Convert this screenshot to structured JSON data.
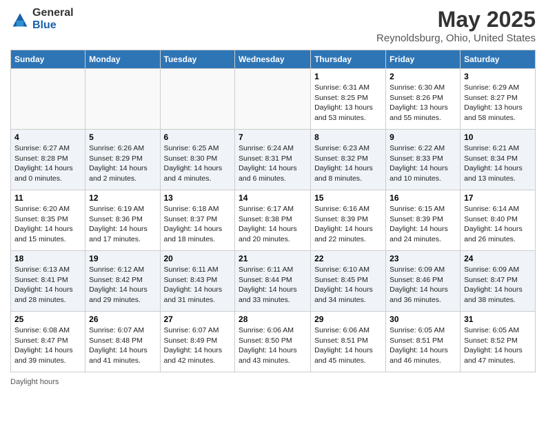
{
  "header": {
    "logo_general": "General",
    "logo_blue": "Blue",
    "main_title": "May 2025",
    "subtitle": "Reynoldsburg, Ohio, United States"
  },
  "days_of_week": [
    "Sunday",
    "Monday",
    "Tuesday",
    "Wednesday",
    "Thursday",
    "Friday",
    "Saturday"
  ],
  "weeks": [
    [
      {
        "day": "",
        "info": ""
      },
      {
        "day": "",
        "info": ""
      },
      {
        "day": "",
        "info": ""
      },
      {
        "day": "",
        "info": ""
      },
      {
        "day": "1",
        "info": "Sunrise: 6:31 AM\nSunset: 8:25 PM\nDaylight: 13 hours\nand 53 minutes."
      },
      {
        "day": "2",
        "info": "Sunrise: 6:30 AM\nSunset: 8:26 PM\nDaylight: 13 hours\nand 55 minutes."
      },
      {
        "day": "3",
        "info": "Sunrise: 6:29 AM\nSunset: 8:27 PM\nDaylight: 13 hours\nand 58 minutes."
      }
    ],
    [
      {
        "day": "4",
        "info": "Sunrise: 6:27 AM\nSunset: 8:28 PM\nDaylight: 14 hours\nand 0 minutes."
      },
      {
        "day": "5",
        "info": "Sunrise: 6:26 AM\nSunset: 8:29 PM\nDaylight: 14 hours\nand 2 minutes."
      },
      {
        "day": "6",
        "info": "Sunrise: 6:25 AM\nSunset: 8:30 PM\nDaylight: 14 hours\nand 4 minutes."
      },
      {
        "day": "7",
        "info": "Sunrise: 6:24 AM\nSunset: 8:31 PM\nDaylight: 14 hours\nand 6 minutes."
      },
      {
        "day": "8",
        "info": "Sunrise: 6:23 AM\nSunset: 8:32 PM\nDaylight: 14 hours\nand 8 minutes."
      },
      {
        "day": "9",
        "info": "Sunrise: 6:22 AM\nSunset: 8:33 PM\nDaylight: 14 hours\nand 10 minutes."
      },
      {
        "day": "10",
        "info": "Sunrise: 6:21 AM\nSunset: 8:34 PM\nDaylight: 14 hours\nand 13 minutes."
      }
    ],
    [
      {
        "day": "11",
        "info": "Sunrise: 6:20 AM\nSunset: 8:35 PM\nDaylight: 14 hours\nand 15 minutes."
      },
      {
        "day": "12",
        "info": "Sunrise: 6:19 AM\nSunset: 8:36 PM\nDaylight: 14 hours\nand 17 minutes."
      },
      {
        "day": "13",
        "info": "Sunrise: 6:18 AM\nSunset: 8:37 PM\nDaylight: 14 hours\nand 18 minutes."
      },
      {
        "day": "14",
        "info": "Sunrise: 6:17 AM\nSunset: 8:38 PM\nDaylight: 14 hours\nand 20 minutes."
      },
      {
        "day": "15",
        "info": "Sunrise: 6:16 AM\nSunset: 8:39 PM\nDaylight: 14 hours\nand 22 minutes."
      },
      {
        "day": "16",
        "info": "Sunrise: 6:15 AM\nSunset: 8:39 PM\nDaylight: 14 hours\nand 24 minutes."
      },
      {
        "day": "17",
        "info": "Sunrise: 6:14 AM\nSunset: 8:40 PM\nDaylight: 14 hours\nand 26 minutes."
      }
    ],
    [
      {
        "day": "18",
        "info": "Sunrise: 6:13 AM\nSunset: 8:41 PM\nDaylight: 14 hours\nand 28 minutes."
      },
      {
        "day": "19",
        "info": "Sunrise: 6:12 AM\nSunset: 8:42 PM\nDaylight: 14 hours\nand 29 minutes."
      },
      {
        "day": "20",
        "info": "Sunrise: 6:11 AM\nSunset: 8:43 PM\nDaylight: 14 hours\nand 31 minutes."
      },
      {
        "day": "21",
        "info": "Sunrise: 6:11 AM\nSunset: 8:44 PM\nDaylight: 14 hours\nand 33 minutes."
      },
      {
        "day": "22",
        "info": "Sunrise: 6:10 AM\nSunset: 8:45 PM\nDaylight: 14 hours\nand 34 minutes."
      },
      {
        "day": "23",
        "info": "Sunrise: 6:09 AM\nSunset: 8:46 PM\nDaylight: 14 hours\nand 36 minutes."
      },
      {
        "day": "24",
        "info": "Sunrise: 6:09 AM\nSunset: 8:47 PM\nDaylight: 14 hours\nand 38 minutes."
      }
    ],
    [
      {
        "day": "25",
        "info": "Sunrise: 6:08 AM\nSunset: 8:47 PM\nDaylight: 14 hours\nand 39 minutes."
      },
      {
        "day": "26",
        "info": "Sunrise: 6:07 AM\nSunset: 8:48 PM\nDaylight: 14 hours\nand 41 minutes."
      },
      {
        "day": "27",
        "info": "Sunrise: 6:07 AM\nSunset: 8:49 PM\nDaylight: 14 hours\nand 42 minutes."
      },
      {
        "day": "28",
        "info": "Sunrise: 6:06 AM\nSunset: 8:50 PM\nDaylight: 14 hours\nand 43 minutes."
      },
      {
        "day": "29",
        "info": "Sunrise: 6:06 AM\nSunset: 8:51 PM\nDaylight: 14 hours\nand 45 minutes."
      },
      {
        "day": "30",
        "info": "Sunrise: 6:05 AM\nSunset: 8:51 PM\nDaylight: 14 hours\nand 46 minutes."
      },
      {
        "day": "31",
        "info": "Sunrise: 6:05 AM\nSunset: 8:52 PM\nDaylight: 14 hours\nand 47 minutes."
      }
    ]
  ],
  "footer": {
    "daylight_label": "Daylight hours"
  }
}
